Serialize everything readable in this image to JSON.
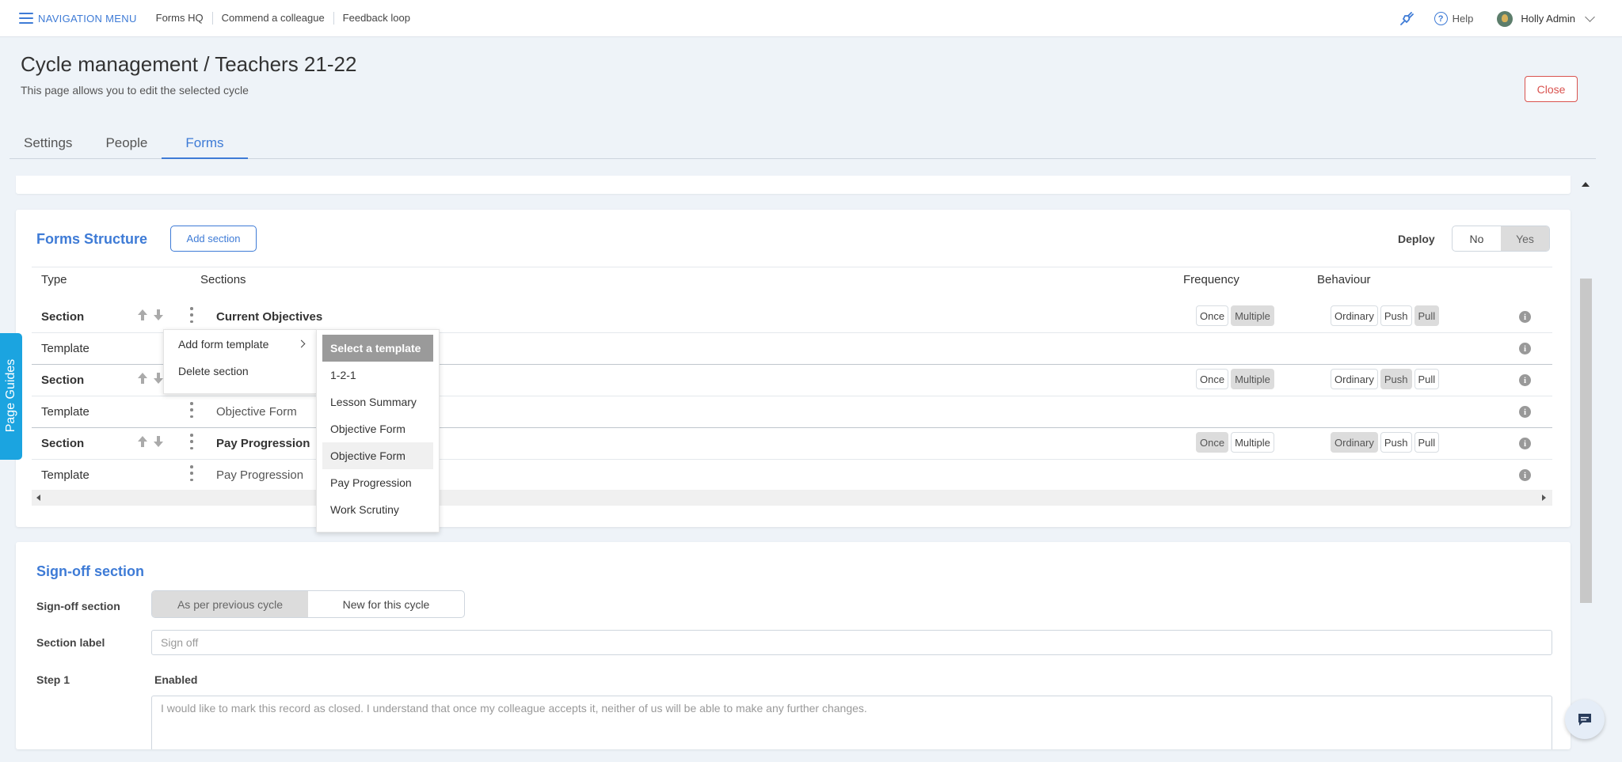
{
  "topnav": {
    "menu_label": "NAVIGATION MENU",
    "links": [
      "Forms HQ",
      "Commend a colleague",
      "Feedback loop"
    ],
    "help_label": "Help",
    "user_name": "Holly Admin"
  },
  "header": {
    "title": "Cycle management / Teachers 21-22",
    "subtitle": "This page allows you to edit the selected cycle",
    "close_label": "Close"
  },
  "tabs": [
    "Settings",
    "People",
    "Forms"
  ],
  "active_tab": "Forms",
  "forms_structure": {
    "title": "Forms Structure",
    "add_section_label": "Add section",
    "deploy_label": "Deploy",
    "deploy_options": [
      "No",
      "Yes"
    ],
    "deploy_selected": "Yes",
    "columns": {
      "type": "Type",
      "sections": "Sections",
      "frequency": "Frequency",
      "behaviour": "Behaviour"
    },
    "rows": [
      {
        "type": "Section",
        "name": "Current Objectives",
        "frequency": [
          "Once",
          "Multiple"
        ],
        "frequency_selected": "Multiple",
        "behaviour": [
          "Ordinary",
          "Push",
          "Pull"
        ],
        "behaviour_selected": "Pull"
      },
      {
        "type": "Template",
        "name": ""
      },
      {
        "type": "Section",
        "name": "",
        "frequency": [
          "Once",
          "Multiple"
        ],
        "frequency_selected": "Multiple",
        "behaviour": [
          "Ordinary",
          "Push",
          "Pull"
        ],
        "behaviour_selected": "Push"
      },
      {
        "type": "Template",
        "name": "Objective Form"
      },
      {
        "type": "Section",
        "name": "Pay Progression",
        "frequency": [
          "Once",
          "Multiple"
        ],
        "frequency_selected": "Once",
        "behaviour": [
          "Ordinary",
          "Push",
          "Pull"
        ],
        "behaviour_selected": "Ordinary"
      },
      {
        "type": "Template",
        "name": "Pay Progression"
      }
    ],
    "info_icon": "i"
  },
  "context_menu": {
    "items": [
      "Add form template",
      "Delete section"
    ]
  },
  "template_submenu": {
    "items": [
      "Select a template",
      "1-2-1",
      "Lesson Summary",
      "Objective Form",
      "Objective Form",
      "Pay Progression",
      "Work Scrutiny"
    ],
    "hovered_index": 4
  },
  "page_guides_label": "Page Guides",
  "signoff": {
    "title": "Sign-off section",
    "field_signoff_label": "Sign-off section",
    "signoff_options": [
      "As per previous cycle",
      "New for this cycle"
    ],
    "signoff_selected": "As per previous cycle",
    "section_label_label": "Section label",
    "section_label_placeholder": "Sign off",
    "step1_label": "Step 1",
    "step1_status": "Enabled",
    "step1_text": "I would like to mark this record as closed. I understand that once my colleague accepts it, neither of us will be able to make any further changes."
  },
  "colors": {
    "accent": "#3e7bd6",
    "danger": "#d9534f",
    "guides": "#1ba4e0",
    "selected_gray": "#dcdcdc"
  }
}
